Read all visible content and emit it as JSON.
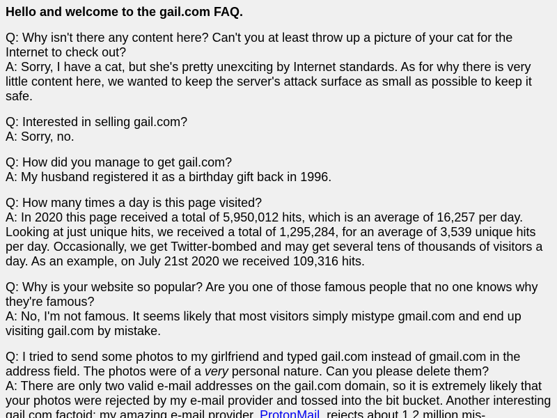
{
  "title": "Hello and welcome to the gail.com FAQ.",
  "faq": [
    {
      "q": "Q: Why isn't there any content here? Can't you at least throw up a picture of your cat for the Internet to check out?",
      "a": "A: Sorry, I have a cat, but she's pretty unexciting by Internet standards. As for why there is very little content here, we wanted to keep the server's attack surface as small as possible to keep it safe."
    },
    {
      "q": "Q: Interested in selling gail.com?",
      "a": "A: Sorry, no."
    },
    {
      "q": "Q: How did you manage to get gail.com?",
      "a": "A: My husband registered it as a birthday gift back in 1996."
    },
    {
      "q": "Q: How many times a day is this page visited?",
      "a": "A: In 2020 this page received a total of 5,950,012 hits, which is an average of 16,257 per day. Looking at just unique hits, we received a total of 1,295,284, for an average of 3,539 unique hits per day. Occasionally, we get Twitter-bombed and may get several tens of thousands of visitors a day. As an example, on July 21st 2020 we received 109,316 hits."
    },
    {
      "q": "Q: Why is your website so popular? Are you one of those famous people that no one knows why they're famous?",
      "a": "A: No, I'm not famous. It seems likely that most visitors simply mistype gmail.com and end up visiting gail.com by mistake."
    },
    {
      "q_part1": "Q: I tried to send some photos to my girlfriend and typed gail.com instead of gmail.com in the address field. The photos were of a ",
      "q_emph": "very",
      "q_part2": " personal nature. Can you please delete them?",
      "a_part1": "A: There are only two valid e-mail addresses on the gail.com domain, so it is extremely likely that your photos were rejected by my e-mail provider and tossed into the bit bucket. Another interesting gail.com factoid: my amazing e-mail provider, ",
      "a_link": "ProtonMail",
      "a_part2": ", rejects about 1.2 million mis-"
    }
  ],
  "colors": {
    "background": "#f0f0f0",
    "text": "#000000",
    "link": "#0000ee"
  }
}
